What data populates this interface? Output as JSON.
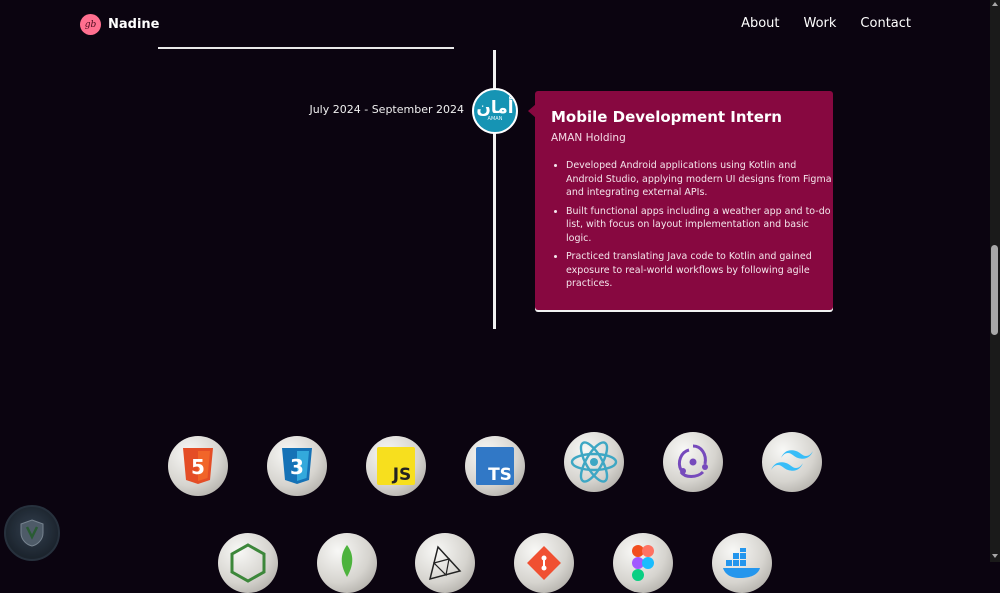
{
  "nav": {
    "brand": "Nadine",
    "logo_text": "gb",
    "links": [
      "About",
      "Work",
      "Contact"
    ]
  },
  "timeline": {
    "date": "July 2024 - September 2024",
    "org_logo_text": "أمان",
    "org_logo_sub": "AMAN",
    "title": "Mobile Development Intern",
    "company": "AMAN Holding",
    "bullets": [
      "Developed Android applications using Kotlin and Android Studio, applying modern UI designs from Figma and integrating external APIs.",
      "Built functional apps including a weather app and to-do list, with focus on layout implementation and basic logic.",
      "Practiced translating Java code to Kotlin and gained exposure to real-world workflows by following agile practices."
    ]
  },
  "skills": {
    "row1": [
      "html5-icon",
      "css3-icon",
      "javascript-icon",
      "typescript-icon",
      "react-icon",
      "redux-icon",
      "tailwind-icon"
    ],
    "row2": [
      "nodejs-icon",
      "mongodb-icon",
      "three-js-icon",
      "git-icon",
      "figma-icon",
      "docker-icon"
    ],
    "labels": {
      "js": "JS",
      "ts": "TS",
      "html": "5",
      "css": "3"
    }
  },
  "colors": {
    "background": "#0b0410",
    "card": "#870840",
    "accent_logo": "#ff6f8f",
    "aman_teal": "#1694b4"
  }
}
